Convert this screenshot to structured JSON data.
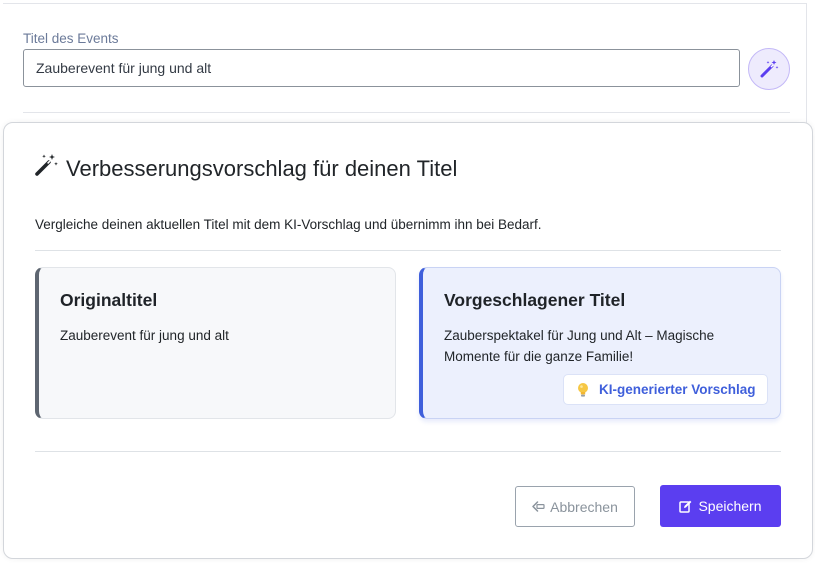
{
  "form": {
    "title_label": "Titel des Events",
    "title_value": "Zauberevent für jung und alt",
    "magic_button_icon": "magic-wand-icon"
  },
  "modal": {
    "header_icon": "magic-wand-icon",
    "title": "Verbesserungsvorschlag für deinen Titel",
    "subtitle": "Vergleiche deinen aktuellen Titel mit dem KI-Vorschlag und übernimm ihn bei Bedarf.",
    "original": {
      "heading": "Originaltitel",
      "text": "Zauberevent für jung und alt"
    },
    "suggested": {
      "heading": "Vorgeschlagener Titel",
      "text": "Zauberspektakel für Jung und Alt – Magische Momente für die ganze Familie!",
      "badge_icon": "lightbulb-icon",
      "badge_label": "KI-generierter Vorschlag"
    },
    "actions": {
      "cancel_label": "Abbrechen",
      "cancel_icon": "arrow-left-icon",
      "save_label": "Speichern",
      "save_icon": "edit-icon"
    }
  },
  "colors": {
    "primary": "#5b3ef0",
    "accent_blue": "#3f5fdb",
    "original_border": "#5e6671",
    "suggested_bg": "#ecf0fd"
  }
}
